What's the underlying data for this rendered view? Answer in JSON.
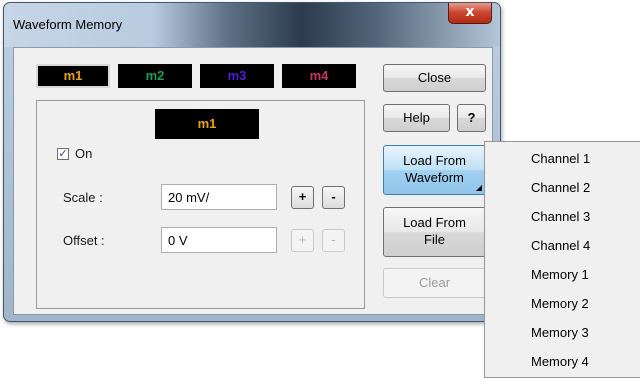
{
  "window": {
    "title": "Waveform Memory",
    "close_glyph": "x"
  },
  "memory_tabs": [
    {
      "label": "m1",
      "color": "#e6a01a",
      "selected": true
    },
    {
      "label": "m2",
      "color": "#1f9a5a",
      "selected": false
    },
    {
      "label": "m3",
      "color": "#4b1fd0",
      "selected": false
    },
    {
      "label": "m4",
      "color": "#c2356b",
      "selected": false
    }
  ],
  "panel": {
    "memory_label": "m1",
    "on_label": "On",
    "on_checked": true,
    "scale_label": "Scale :",
    "scale_value": "20 mV/",
    "offset_label": "Offset :",
    "offset_value": "0 V",
    "plus": "+",
    "minus": "-"
  },
  "buttons": {
    "close": "Close",
    "help": "Help",
    "help_icon": "?",
    "load_from_waveform_line1": "Load From",
    "load_from_waveform_line2": "Waveform",
    "load_from_file_line1": "Load From",
    "load_from_file_line2": "File",
    "clear": "Clear"
  },
  "dropdown": {
    "items": [
      "Channel 1",
      "Channel 2",
      "Channel 3",
      "Channel 4",
      "Memory 1",
      "Memory 2",
      "Memory 3",
      "Memory 4"
    ]
  },
  "colors": {
    "accent_active": "#8ec5ea",
    "title_bar": "#5e7186",
    "close_red": "#c8442c"
  }
}
